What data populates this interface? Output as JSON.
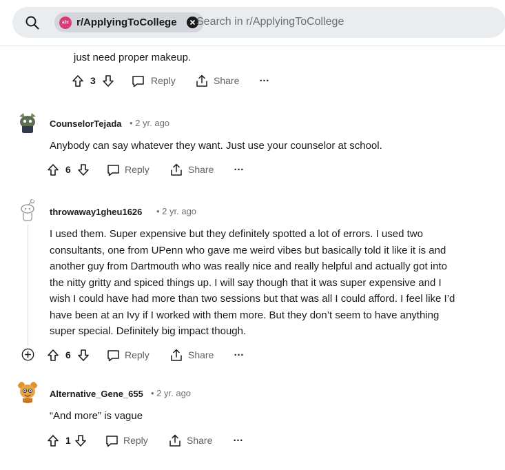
{
  "search": {
    "subreddit_chip": "r/ApplyingToCollege",
    "chip_avatar": "a2c",
    "placeholder": "Search in r/ApplyingToCollege"
  },
  "actions": {
    "reply_label": "Reply",
    "share_label": "Share",
    "more_label": "…"
  },
  "partial_comment": {
    "text": "just need proper makeup.",
    "votes": "3"
  },
  "comments": [
    {
      "username": "CounselorTejada",
      "time": "2 yr. ago",
      "text": "Anybody can say whatever they want. Just use your counselor at school.",
      "votes": "6"
    },
    {
      "username": "throwaway1gheu1626",
      "time": "2 yr. ago",
      "lines": [
        "I used them. Super expensive but they definitely spotted a lot of errors. I used two",
        "consultants, one from UPenn who gave me weird vibes but basically told it like it is and",
        "another guy from Dartmouth who was really nice and really helpful and actually got into",
        "the nitty gritty and spiced things up. I will say though that it was super expensive and I",
        "wish I could have had more than two sessions but that was all I could afford. I feel like I’d",
        "have been at an Ivy if I worked with them more. But they don’t seem to have anything",
        "super special. Definitely big impact though."
      ],
      "votes": "6"
    },
    {
      "username": "Alternative_Gene_655",
      "time": "2 yr. ago",
      "text": "“And more” is vague",
      "votes": "1"
    }
  ]
}
